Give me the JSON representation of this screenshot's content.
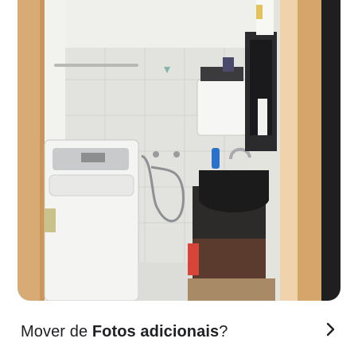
{
  "photo": {
    "description_icon": "bathroom-photo"
  },
  "prompt": {
    "prefix": "Mover de ",
    "album": "Fotos adicionais",
    "suffix": "?"
  },
  "icons": {
    "chevron": "chevron-right-icon"
  },
  "colors": {
    "text": "#202124",
    "wall": "#e6e6e2",
    "door_frame": "#d8a86f"
  }
}
